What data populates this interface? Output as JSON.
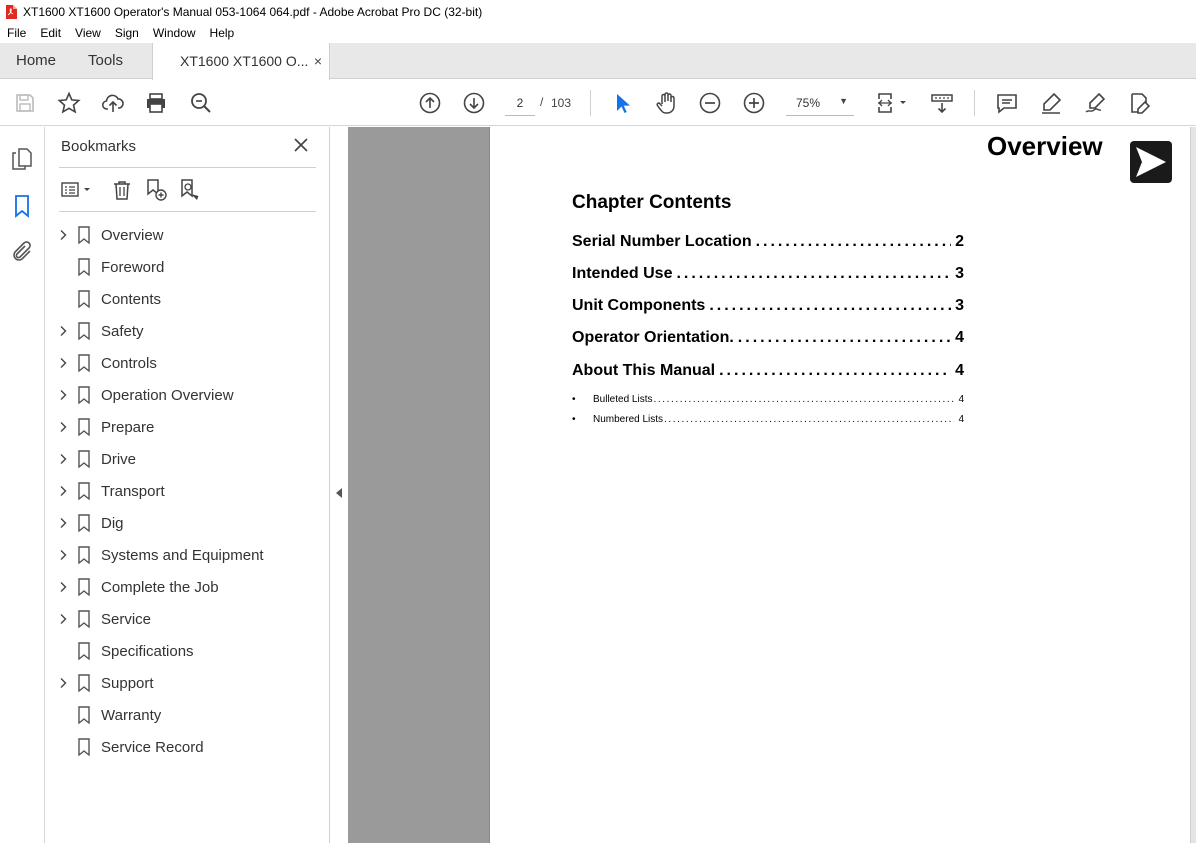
{
  "window": {
    "title": "XT1600 XT1600 Operator's Manual 053-1064 064.pdf - Adobe Acrobat Pro DC (32-bit)"
  },
  "menu": [
    "File",
    "Edit",
    "View",
    "Sign",
    "Window",
    "Help"
  ],
  "tabs": {
    "home": "Home",
    "tools": "Tools",
    "doc": "XT1600 XT1600 O...",
    "close_glyph": "×"
  },
  "toolbar": {
    "page_current": "2",
    "page_sep": "/",
    "page_total": "103",
    "zoom": "75%",
    "icons": [
      "save-icon",
      "star-icon",
      "upload-icon",
      "print-icon",
      "zoom-search-icon",
      "page-up-icon",
      "page-down-icon",
      "select-cursor-icon",
      "hand-icon",
      "zoom-out-icon",
      "zoom-in-icon",
      "page-fit-icon",
      "scroll-icon",
      "comment-icon",
      "highlight-icon",
      "sign-icon",
      "edit-icon"
    ],
    "accent_color": "#1473e6"
  },
  "bookmarks": {
    "title": "Bookmarks",
    "items": [
      {
        "label": "Overview",
        "expandable": true
      },
      {
        "label": "Foreword",
        "expandable": false
      },
      {
        "label": "Contents",
        "expandable": false
      },
      {
        "label": "Safety",
        "expandable": true
      },
      {
        "label": "Controls",
        "expandable": true
      },
      {
        "label": "Operation Overview",
        "expandable": true
      },
      {
        "label": "Prepare",
        "expandable": true
      },
      {
        "label": "Drive",
        "expandable": true
      },
      {
        "label": "Transport",
        "expandable": true
      },
      {
        "label": "Dig",
        "expandable": true
      },
      {
        "label": "Systems and Equipment",
        "expandable": true
      },
      {
        "label": "Complete the Job",
        "expandable": true
      },
      {
        "label": "Service",
        "expandable": true
      },
      {
        "label": "Specifications",
        "expandable": false
      },
      {
        "label": "Support",
        "expandable": true
      },
      {
        "label": "Warranty",
        "expandable": false
      },
      {
        "label": "Service Record",
        "expandable": false
      }
    ]
  },
  "document": {
    "heading": "Overview",
    "chapter_title": "Chapter Contents",
    "toc": [
      {
        "label": "Serial Number Location",
        "page": "2"
      },
      {
        "label": "Intended Use",
        "page": "3"
      },
      {
        "label": "Unit Components",
        "page": "3"
      },
      {
        "label": "Operator Orientation.",
        "page": "4"
      },
      {
        "label": "About This Manual",
        "page": "4"
      }
    ],
    "subtoc": [
      {
        "bullet": "•",
        "label": "Bulleted Lists",
        "page": "4"
      },
      {
        "bullet": "•",
        "label": "Numbered Lists",
        "page": "4"
      }
    ]
  }
}
